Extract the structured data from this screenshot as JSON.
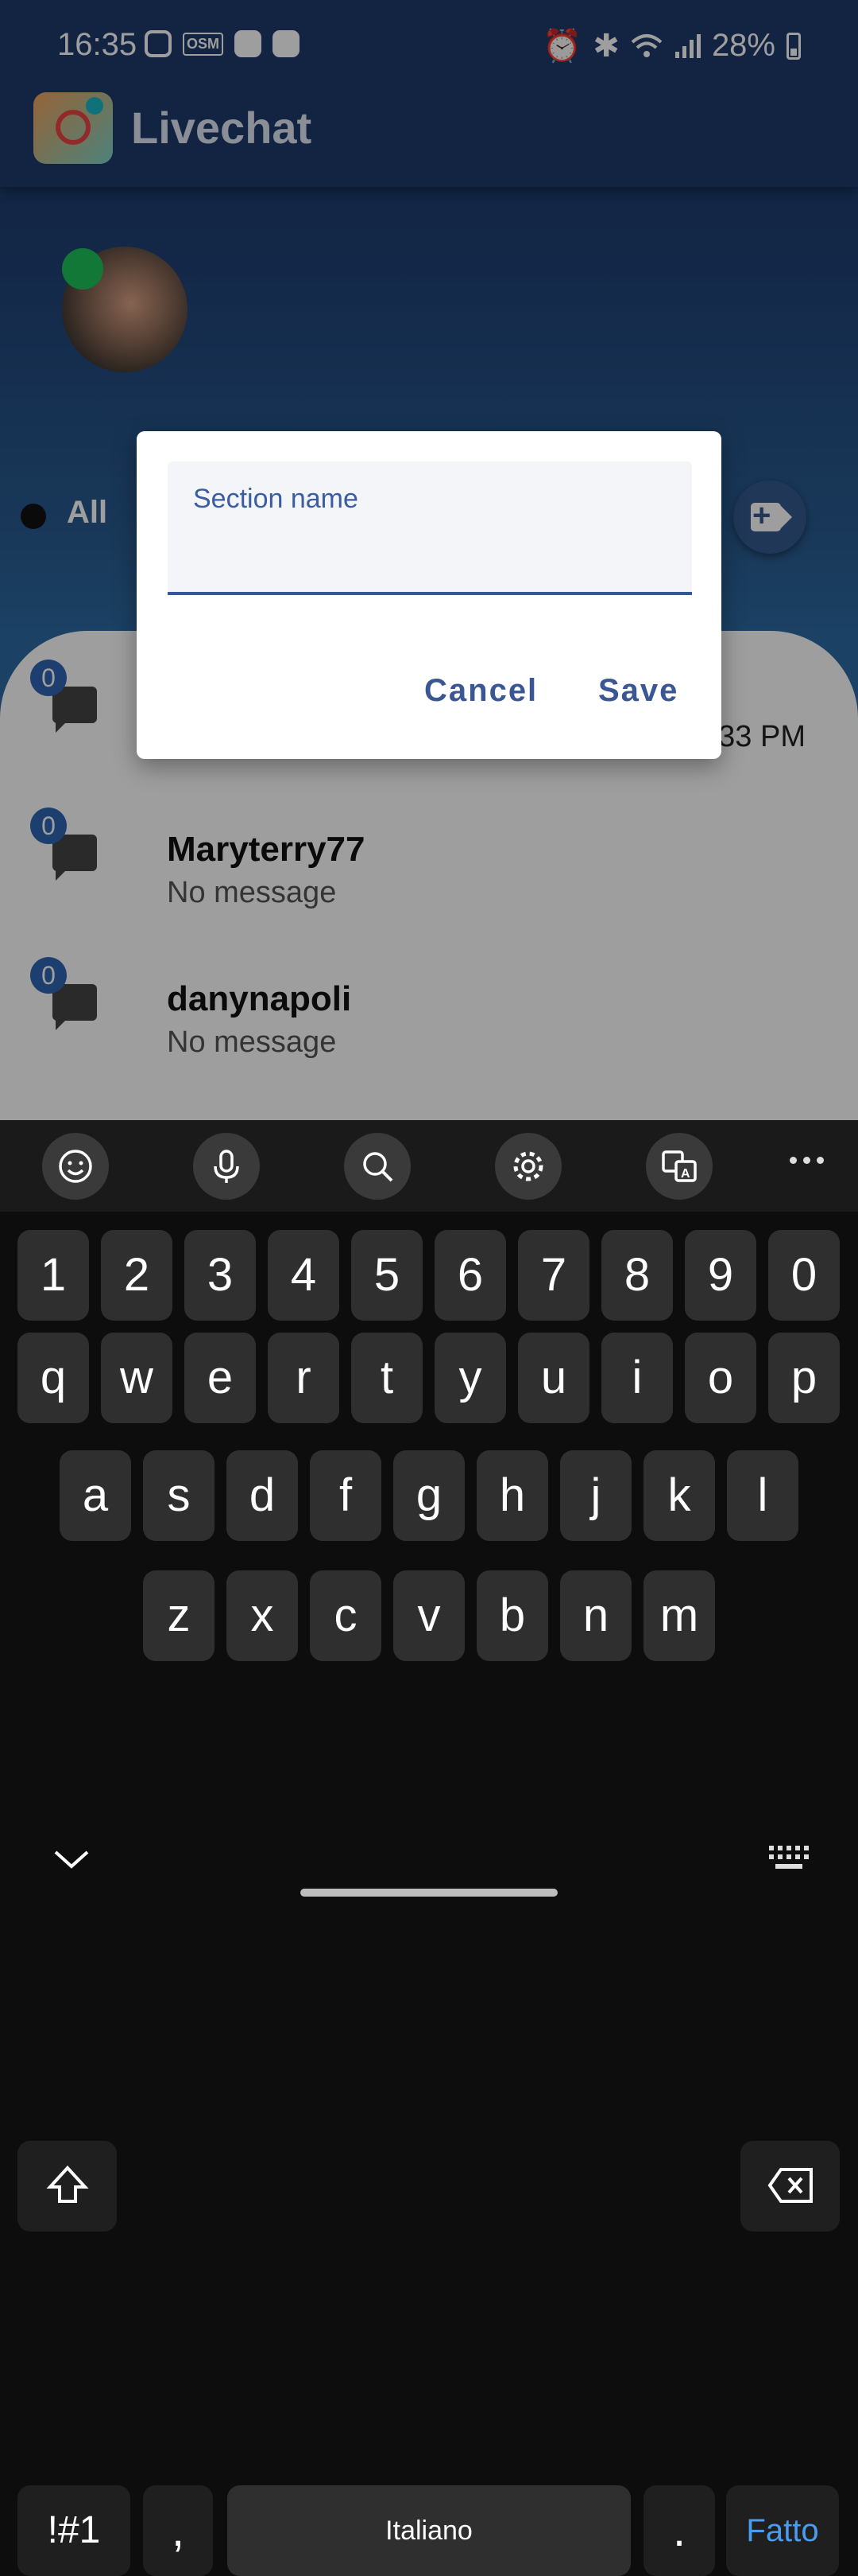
{
  "status_bar": {
    "time": "16:35",
    "osm_label": "OSM",
    "battery": "28%"
  },
  "app": {
    "title": "Livechat"
  },
  "filters": {
    "all_label": "All"
  },
  "chats": [
    {
      "badge": "0",
      "name": "",
      "message": "",
      "time": "3:33 PM"
    },
    {
      "badge": "0",
      "name": "Maryterry77",
      "message": "No message",
      "time": ""
    },
    {
      "badge": "0",
      "name": "danynapoli",
      "message": "No message",
      "time": ""
    }
  ],
  "dialog": {
    "field_label": "Section name",
    "field_value": "",
    "cancel_label": "Cancel",
    "save_label": "Save"
  },
  "keyboard": {
    "toolbar_icons": [
      "emoji-icon",
      "microphone-icon",
      "search-icon",
      "settings-icon",
      "translate-icon",
      "more-icon"
    ],
    "row_numbers": [
      "1",
      "2",
      "3",
      "4",
      "5",
      "6",
      "7",
      "8",
      "9",
      "0"
    ],
    "row_1": [
      "q",
      "w",
      "e",
      "r",
      "t",
      "y",
      "u",
      "i",
      "o",
      "p"
    ],
    "row_2": [
      "a",
      "s",
      "d",
      "f",
      "g",
      "h",
      "j",
      "k",
      "l"
    ],
    "row_3": [
      "z",
      "x",
      "c",
      "v",
      "b",
      "n",
      "m"
    ],
    "symbols_label": "!#1",
    "comma_label": ",",
    "space_label": "Italiano",
    "period_label": ".",
    "done_label": "Fatto"
  }
}
